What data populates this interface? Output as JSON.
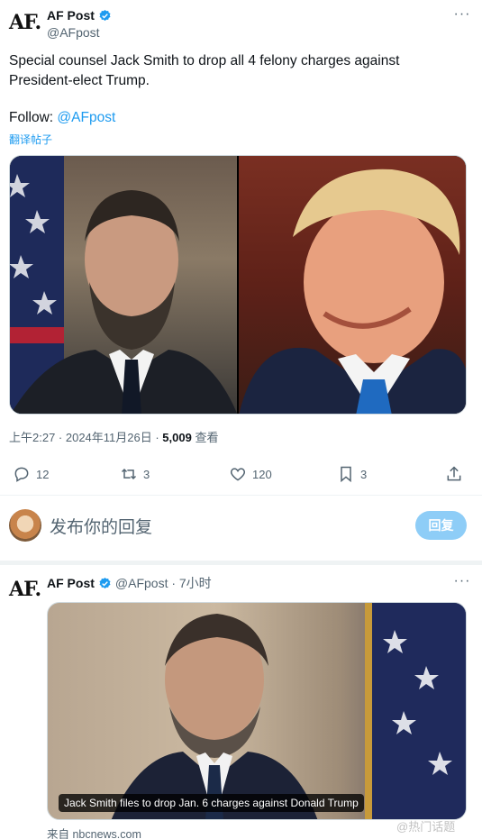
{
  "post": {
    "display_name": "AF Post",
    "handle": "@AFpost",
    "text": "Special counsel Jack Smith to drop all 4 felony charges against President-elect Trump.",
    "follow_label": "Follow:",
    "follow_mention": "@AFpost",
    "translate": "翻译帖子",
    "timestamp": "上午2:27 · 2024年11月26日 ·",
    "views_count": "5,009",
    "views_label": "查看",
    "stats": {
      "replies": "12",
      "reposts": "3",
      "likes": "120",
      "bookmarks": "3"
    },
    "logo_text": "AF."
  },
  "reply": {
    "placeholder": "发布你的回复",
    "button": "回复"
  },
  "post2": {
    "logo_text": "AF.",
    "display_name": "AF Post",
    "handle_time": "@AFpost · 7小时",
    "card_caption": "Jack Smith files to drop Jan. 6 charges against Donald Trump",
    "card_source": "来自 nbcnews.com"
  },
  "watermark": "@热门话题"
}
